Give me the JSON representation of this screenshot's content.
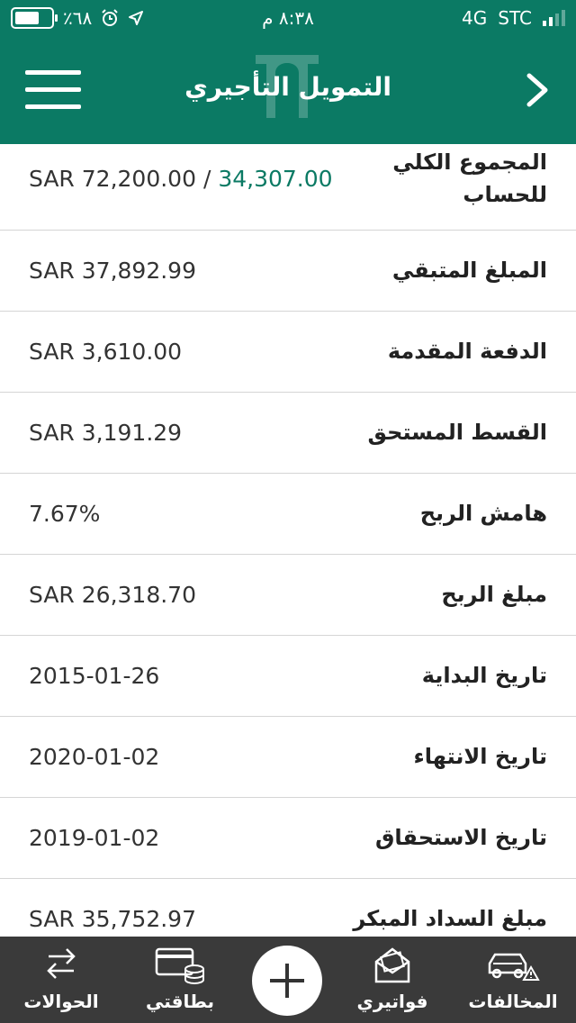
{
  "status_bar": {
    "battery": "٪٦٨",
    "time": "٨:٣٨ م",
    "network": "4G",
    "carrier": "STC"
  },
  "nav": {
    "title": "التمويل التأجيري",
    "menu_icon": "hamburger-menu-icon",
    "forward_icon": "chevron-right-icon"
  },
  "details": {
    "rows": [
      {
        "label": "المجموع الكلي للحساب",
        "paid": "34,307.00",
        "separator": " / ",
        "total": "SAR 72,200.00"
      },
      {
        "label": "المبلغ المتبقي",
        "value": "SAR 37,892.99"
      },
      {
        "label": "الدفعة المقدمة",
        "value": "SAR 3,610.00"
      },
      {
        "label": "القسط المستحق",
        "value": "SAR 3,191.29"
      },
      {
        "label": "هامش الربح",
        "value": "7.67%"
      },
      {
        "label": "مبلغ الربح",
        "value": "SAR 26,318.70"
      },
      {
        "label": "تاريخ البداية",
        "value": "2015-01-26"
      },
      {
        "label": "تاريخ الانتهاء",
        "value": "2020-01-02"
      },
      {
        "label": "تاريخ الاستحقاق",
        "value": "2019-01-02"
      },
      {
        "label": "مبلغ السداد المبكر",
        "value": "SAR 35,752.97"
      }
    ]
  },
  "tabs": {
    "transfers": "الحوالات",
    "my_cards": "بطاقتي",
    "add": "+",
    "my_bills": "فواتيري",
    "violations": "المخالفات"
  },
  "colors": {
    "primary": "#0b7a64",
    "tabbar": "#3a3a3a"
  }
}
